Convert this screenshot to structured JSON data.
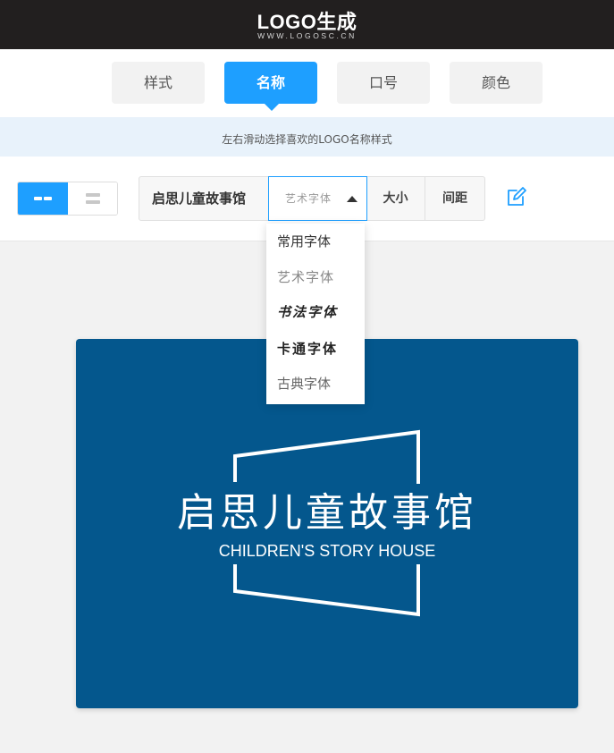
{
  "header": {
    "brand": "LOGO生成",
    "domain": "WWW.LOGOSC.CN"
  },
  "tabs": [
    {
      "label": "样式",
      "active": false
    },
    {
      "label": "名称",
      "active": true
    },
    {
      "label": "口号",
      "active": false
    },
    {
      "label": "颜色",
      "active": false
    }
  ],
  "hint": "左右滑动选择喜欢的LOGO名称样式",
  "toolbar": {
    "name_value": "启思儿童故事馆",
    "font_selected": "艺术字体",
    "size_label": "大小",
    "spacing_label": "间距"
  },
  "font_options": [
    "常用字体",
    "艺术字体",
    "书法字体",
    "卡通字体",
    "古典字体"
  ],
  "logo": {
    "title": "启思儿童故事馆",
    "subtitle": "CHILDREN'S STORY HOUSE",
    "background_color": "#04578d"
  },
  "colors": {
    "accent": "#1e9fff",
    "topbar": "#221f1f"
  },
  "icons": {
    "layout_horizontal": "horizontal-layout-icon",
    "layout_vertical": "vertical-layout-icon",
    "edit": "edit-icon"
  }
}
